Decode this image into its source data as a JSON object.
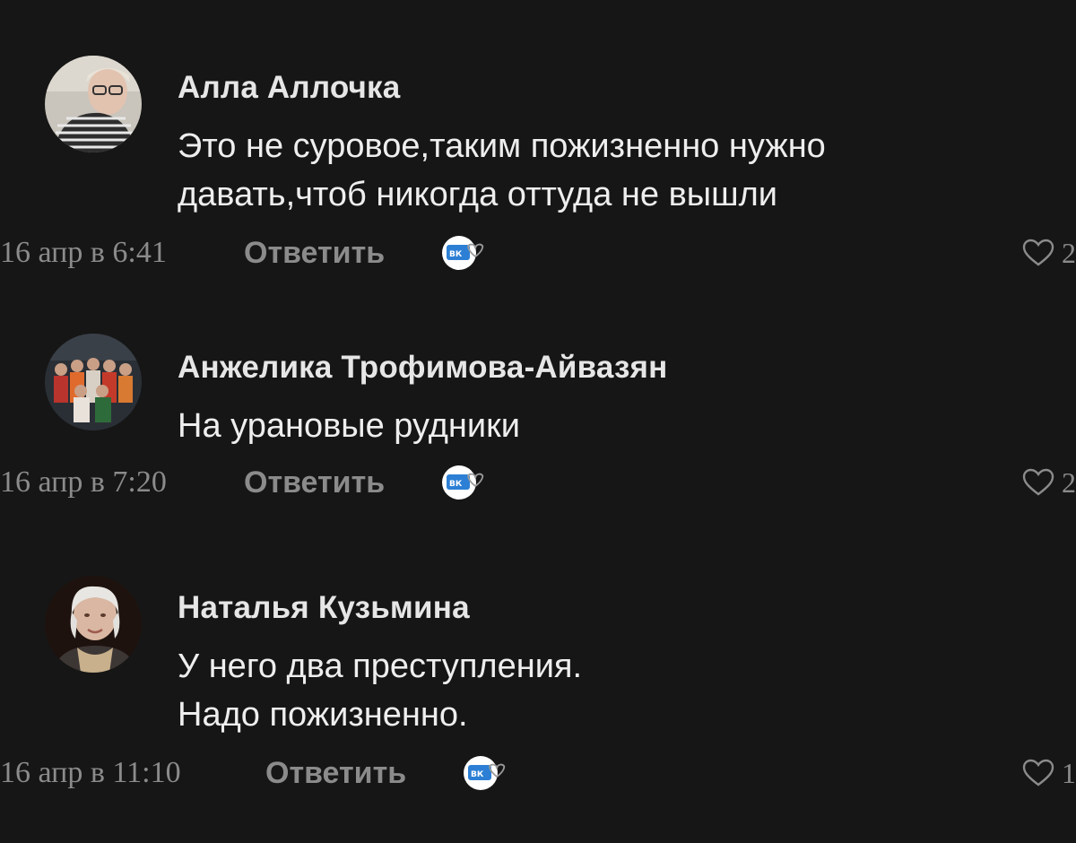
{
  "comments": [
    {
      "author": "Алла Аллочка",
      "lines": [
        "Это не суровое,таким пожизненно нужно",
        "давать,чтоб никогда оттуда не вышли"
      ],
      "date": "16 апр в 6:41",
      "reply_label": "Ответить",
      "likes": "2"
    },
    {
      "author": "Анжелика Трофимова-Айвазян",
      "lines": [
        "На урановые рудники"
      ],
      "date": "16 апр в 7:20",
      "reply_label": "Ответить",
      "likes": "2"
    },
    {
      "author": "Наталья Кузьмина",
      "lines": [
        "У него два преступления.",
        "Надо пожизненно."
      ],
      "date": "16 апр в 11:10",
      "reply_label": "Ответить",
      "likes": "1"
    }
  ],
  "badge_text": "ВК",
  "icons": {
    "like": "heart-icon",
    "badge": "vk-badge-icon"
  },
  "colors": {
    "background": "#161616",
    "text": "#eeeeee",
    "muted": "#8b8b8b",
    "badge_blue": "#2c7fd4"
  }
}
